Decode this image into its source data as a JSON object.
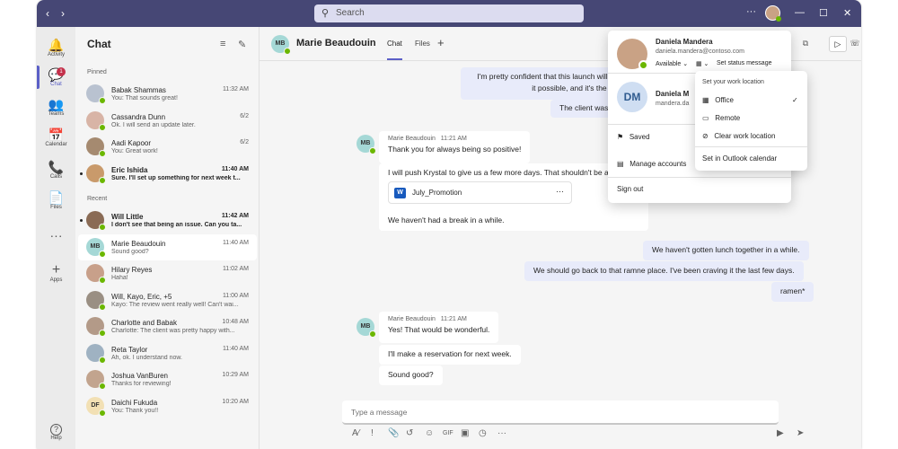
{
  "titlebar": {
    "search_placeholder": "Search",
    "more": "···",
    "minimize": "—",
    "maximize": "☐",
    "close": "✕"
  },
  "rail": {
    "items": [
      {
        "label": "Activity",
        "glyph": "🔔"
      },
      {
        "label": "Chat",
        "glyph": "💬",
        "badge": "1"
      },
      {
        "label": "Teams",
        "glyph": "👥"
      },
      {
        "label": "Calendar",
        "glyph": "📅"
      },
      {
        "label": "Calls",
        "glyph": "📞"
      },
      {
        "label": "Files",
        "glyph": "📄"
      },
      {
        "label": "",
        "glyph": "···"
      },
      {
        "label": "Apps",
        "glyph": "+"
      },
      {
        "label": "Help",
        "glyph": "?"
      }
    ]
  },
  "chatlist": {
    "title": "Chat",
    "pinned_label": "Pinned",
    "recent_label": "Recent",
    "pinned": [
      {
        "name": "Babak Shammas",
        "preview": "You: That sounds great!",
        "time": "11:32 AM",
        "color": "#b9c2d0"
      },
      {
        "name": "Cassandra Dunn",
        "preview": "Ok. I will send an update later.",
        "time": "6/2",
        "color": "#d8b4a6"
      },
      {
        "name": "Aadi Kapoor",
        "preview": "You: Great work!",
        "time": "6/2",
        "color": "#a58a70"
      },
      {
        "name": "Eric Ishida",
        "preview": "Sure. I'll set up something for next week t...",
        "time": "11:40 AM",
        "color": "#c99a6b",
        "unread": true
      }
    ],
    "recent": [
      {
        "name": "Will Little",
        "preview": "I don't see that being an issue. Can you ta...",
        "time": "11:42 AM",
        "color": "#8a6b55",
        "unread": true
      },
      {
        "name": "Marie Beaudouin",
        "preview": "Sound good?",
        "time": "11:40 AM",
        "initials": "MB",
        "color": "#a5d8d6",
        "selected": true
      },
      {
        "name": "Hilary Reyes",
        "preview": "Haha!",
        "time": "11:02 AM",
        "color": "#c8a08a"
      },
      {
        "name": "Will, Kayo, Eric, +5",
        "preview": "Kayo: The review went really well! Can't wai...",
        "time": "11:00 AM",
        "color": "#9a8f83"
      },
      {
        "name": "Charlotte and Babak",
        "preview": "Charlotte: The client was pretty happy with...",
        "time": "10:48 AM",
        "color": "#b39a88"
      },
      {
        "name": "Reta Taylor",
        "preview": "Ah, ok. I understand now.",
        "time": "11:40 AM",
        "color": "#9fb2c2"
      },
      {
        "name": "Joshua VanBuren",
        "preview": "Thanks for reviewing!",
        "time": "10:29 AM",
        "color": "#c2a48e"
      },
      {
        "name": "Daichi Fukuda",
        "preview": "You: Thank you!!",
        "time": "10:20 AM",
        "initials": "DF",
        "color": "#f2e0b4"
      }
    ]
  },
  "header": {
    "initials": "MB",
    "name": "Marie Beaudouin",
    "tab_chat": "Chat",
    "tab_files": "Files",
    "add_tab": "+"
  },
  "messages": {
    "sent1": "I'm pretty confident that this launch will be succe",
    "sent1b": "it possible, and it's the best tean",
    "sent2": "The client wasn't expect",
    "group1_meta_name": "Marie Beaudouin",
    "group1_meta_time": "11:21 AM",
    "m1": "Thank you for always being so positive!",
    "m2": "I will push Krystal to give us a few more days. That shouldn't be a problem",
    "file_name": "July_Promotion",
    "m3": "We haven't had a break in a while.",
    "s3": "We haven't gotten lunch together in a while.",
    "s4": "We should go back to that ramne place. I've been craving it the last few days.",
    "s5": "ramen*",
    "group2_meta_name": "Marie Beaudouin",
    "group2_meta_time": "11:21 AM",
    "m4": "Yes! That would be wonderful.",
    "m5": "I'll make a reservation for next week.",
    "m6": "Sound good?"
  },
  "compose": {
    "placeholder": "Type a message"
  },
  "profile": {
    "name": "Daniela Mandera",
    "email": "daniela.mandera@contoso.com",
    "status": "Available",
    "set_status": "Set status message",
    "account2_initials": "DM",
    "account2_name": "Daniela M",
    "account2_email": "mandera.da",
    "saved": "Saved",
    "manage_accounts": "Manage accounts",
    "sign_out": "Sign out"
  },
  "location_menu": {
    "header": "Set your work location",
    "office": "Office",
    "remote": "Remote",
    "clear": "Clear work location",
    "outlook": "Set in Outlook calendar"
  },
  "colors": {
    "titlebar": "#464775",
    "accent": "#5b5fc7",
    "presence": "#6bb700"
  }
}
